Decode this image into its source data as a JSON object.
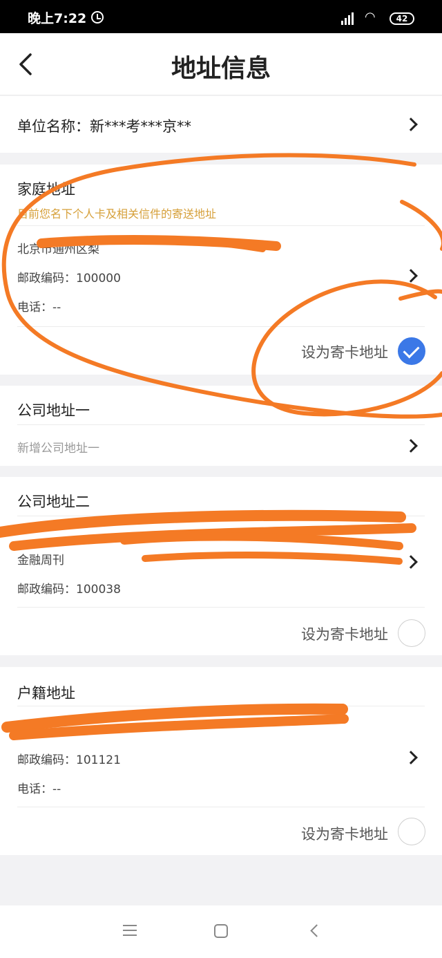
{
  "status_bar": {
    "time": "晚上7:22",
    "network": "HD",
    "battery": "42"
  },
  "header": {
    "title": "地址信息"
  },
  "unit": {
    "label": "单位名称：新***考***京**"
  },
  "home_address": {
    "title": "家庭地址",
    "hint": "目前您名下个人卡及相关信件的寄送地址",
    "address_line": "北京市通州区梨",
    "postcode": "邮政编码：100000",
    "phone": "电话：--",
    "set_label": "设为寄卡地址",
    "selected": true
  },
  "company_address_1": {
    "title": "公司地址一",
    "add_label": "新增公司地址一"
  },
  "company_address_2": {
    "title": "公司地址二",
    "company_line": "金融周刊",
    "postcode": "邮政编码：100038",
    "set_label": "设为寄卡地址",
    "selected": false
  },
  "household_address": {
    "title": "户籍地址",
    "postcode": "邮政编码：101121",
    "phone": "电话：--",
    "set_label": "设为寄卡地址",
    "selected": false
  },
  "colors": {
    "accent": "#3b78e7",
    "hint": "#d6a03a",
    "scribble": "#f47a25"
  }
}
